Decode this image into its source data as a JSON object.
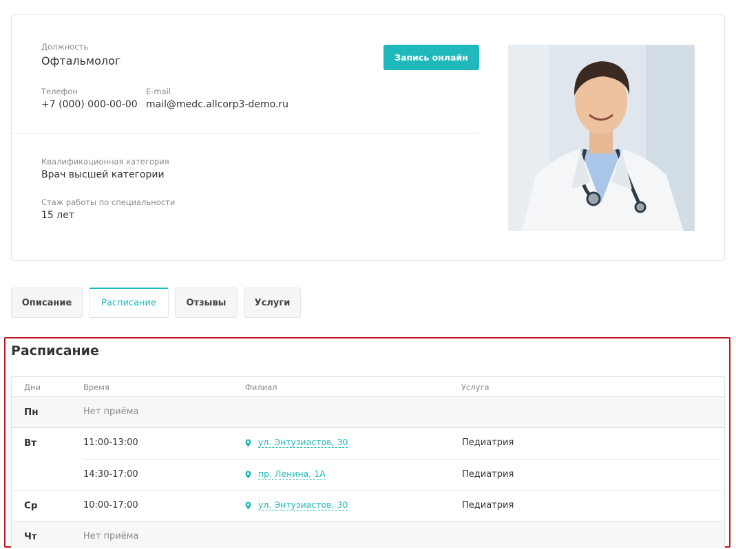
{
  "doctor": {
    "position_label": "Должность",
    "position_value": "Офтальмолог",
    "phone_label": "Телефон",
    "phone_value": "+7 (000) 000-00-00",
    "email_label": "E-mail",
    "email_value": "mail@medc.allcorp3-demo.ru",
    "category_label": "Квалификационная категория",
    "category_value": "Врач высшей категории",
    "experience_label": "Стаж работы по специальности",
    "experience_value": "15 лет",
    "online_button": "Запись онлайн"
  },
  "tabs": [
    {
      "label": "Описание",
      "active": false
    },
    {
      "label": "Расписание",
      "active": true
    },
    {
      "label": "Отзывы",
      "active": false
    },
    {
      "label": "Услуги",
      "active": false
    }
  ],
  "schedule": {
    "title": "Расписание",
    "headers": {
      "days": "Дни",
      "time": "Время",
      "branch": "Филиал",
      "service": "Услуга"
    },
    "rows": [
      {
        "day": "Пн",
        "no_reception": "Нет приёма"
      },
      {
        "day": "Вт",
        "slots": [
          {
            "time": "11:00-13:00",
            "branch": "ул. Энтузиастов, 30",
            "service": "Педиатрия"
          },
          {
            "time": "14:30-17:00",
            "branch": "пр. Ленина, 1А",
            "service": "Педиатрия"
          }
        ]
      },
      {
        "day": "Ср",
        "slots": [
          {
            "time": "10:00-17:00",
            "branch": "ул. Энтузиастов, 30",
            "service": "Педиатрия"
          }
        ]
      },
      {
        "day": "Чт",
        "no_reception": "Нет приёма"
      }
    ]
  },
  "colors": {
    "accent": "#20b9bb",
    "highlight_border": "#c0141c",
    "label_grey": "#8a8a8a"
  }
}
